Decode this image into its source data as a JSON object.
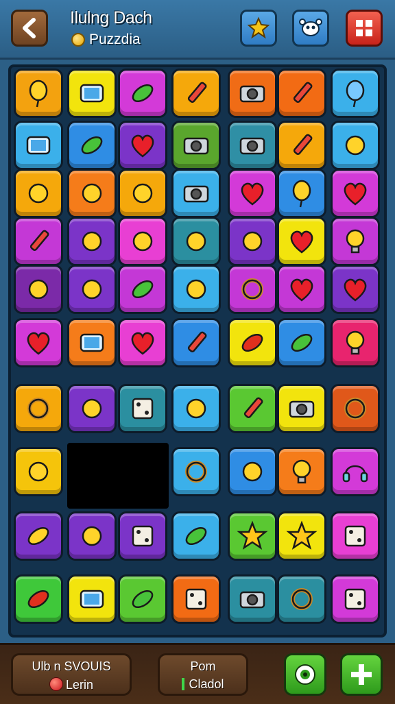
{
  "header": {
    "title": "Ilulng Dach",
    "subtitle": "Puzzdia",
    "back_icon": "back-arrow-icon",
    "buttons": [
      {
        "name": "star-badge-button",
        "icon": "star-badge-icon",
        "color": "#3f8fd6"
      },
      {
        "name": "character-button",
        "icon": "character-icon",
        "color": "#3f8fd6"
      },
      {
        "name": "grid-menu-button",
        "icon": "grid-icon",
        "color": "#e53a2a"
      }
    ]
  },
  "board": {
    "tiles": [
      {
        "bg": "#f3a20f",
        "icon": "balloon"
      },
      {
        "bg": "#f2e40d",
        "icon": "tablet"
      },
      {
        "bg": "#d33ad8",
        "icon": "pickle"
      },
      {
        "bg": "#f5a80b",
        "icon": "marker"
      },
      {
        "bg": "#f06c16",
        "icon": "machine"
      },
      {
        "bg": "#f26b14",
        "icon": "pen"
      },
      {
        "bg": "#3bb0ea",
        "icon": "water-drop"
      },
      {
        "bg": "#3bb0ea",
        "icon": "phone"
      },
      {
        "bg": "#2f8de4",
        "icon": "cucumber"
      },
      {
        "bg": "#7b34c8",
        "icon": "heart"
      },
      {
        "bg": "#5aa62d",
        "icon": "toaster"
      },
      {
        "bg": "#2f8fa5",
        "icon": "camera"
      },
      {
        "bg": "#f5a80b",
        "icon": "leaf-pen"
      },
      {
        "bg": "#3bb0ea",
        "icon": "tools"
      },
      {
        "bg": "#f5a80b",
        "icon": "dragon"
      },
      {
        "bg": "#f57c1a",
        "icon": "pig"
      },
      {
        "bg": "#f5a80b",
        "icon": "grass"
      },
      {
        "bg": "#3bb0ea",
        "icon": "radio"
      },
      {
        "bg": "#d33ad8",
        "icon": "heart"
      },
      {
        "bg": "#2f8de4",
        "icon": "balloon"
      },
      {
        "bg": "#d33ad8",
        "icon": "heart-balloon"
      },
      {
        "bg": "#c438d6",
        "icon": "pencil"
      },
      {
        "bg": "#7b34c8",
        "icon": "drops"
      },
      {
        "bg": "#e83fd3",
        "icon": "cheese"
      },
      {
        "bg": "#2b8fa0",
        "icon": "flashlight"
      },
      {
        "bg": "#7b34c8",
        "icon": "puzzle"
      },
      {
        "bg": "#f2e40d",
        "icon": "heart"
      },
      {
        "bg": "#c438d6",
        "icon": "lightbulb"
      },
      {
        "bg": "#7b2aa8",
        "icon": "rolling-pin"
      },
      {
        "bg": "#7b34c8",
        "icon": "bottle"
      },
      {
        "bg": "#c438d6",
        "icon": "leaf"
      },
      {
        "bg": "#3bb0ea",
        "icon": "bird"
      },
      {
        "bg": "#c438d6",
        "icon": "donut"
      },
      {
        "bg": "#c438d6",
        "icon": "heart-balloon"
      },
      {
        "bg": "#7b34c8",
        "icon": "heart"
      },
      {
        "bg": "#d33ad8",
        "icon": "heart"
      },
      {
        "bg": "#f57c1a",
        "icon": "phone-case"
      },
      {
        "bg": "#e83fd3",
        "icon": "heart"
      },
      {
        "bg": "#2f8de4",
        "icon": "marker"
      },
      {
        "bg": "#f2e40d",
        "icon": "chili"
      },
      {
        "bg": "#2f8de4",
        "icon": "speech"
      },
      {
        "bg": "#e8246e",
        "icon": "lightbulb"
      },
      {
        "bg": "#f5a80b",
        "icon": "ring"
      },
      {
        "bg": "#7b34c8",
        "icon": "scooter"
      },
      {
        "bg": "#2b8fa0",
        "icon": "dice"
      },
      {
        "bg": "#3bb0ea",
        "icon": "cookie"
      },
      {
        "bg": "#5ac832",
        "icon": "crayon"
      },
      {
        "bg": "#f2e40d",
        "icon": "device"
      },
      {
        "bg": "#e0581a",
        "icon": "no-sign"
      },
      {
        "bg": "#f5c40b",
        "icon": "joystick"
      },
      {
        "bg": "#3bb0ea",
        "icon": "magnifier"
      },
      {
        "bg": "#2f8de4",
        "icon": "hammer"
      },
      {
        "bg": "#f57c1a",
        "icon": "lightbulb"
      },
      {
        "bg": "#d33ad8",
        "icon": "headphones"
      },
      {
        "bg": "#7b34c8",
        "icon": "banana"
      },
      {
        "bg": "#7b34c8",
        "icon": "hairdryer"
      },
      {
        "bg": "#7b34c8",
        "icon": "book"
      },
      {
        "bg": "#3bb0ea",
        "icon": "leaf-pot"
      },
      {
        "bg": "#5ac832",
        "icon": "star"
      },
      {
        "bg": "#f2e40d",
        "icon": "star"
      },
      {
        "bg": "#e83fd3",
        "icon": "frame"
      },
      {
        "bg": "#3fc83a",
        "icon": "bean"
      },
      {
        "bg": "#f2e40d",
        "icon": "phone"
      },
      {
        "bg": "#5ac832",
        "icon": "speech"
      },
      {
        "bg": "#f26b14",
        "icon": "box"
      },
      {
        "bg": "#2b8fa0",
        "icon": "camera"
      },
      {
        "bg": "#2b8fa0",
        "icon": "gear-ring"
      },
      {
        "bg": "#d33ad8",
        "icon": "picture-frame"
      }
    ]
  },
  "footer": {
    "left_panel": {
      "line1": "Ulb n SVOUIS",
      "line2": "Lerin"
    },
    "center_panel": {
      "line1": "Pom",
      "line2": "Cladol"
    },
    "buttons": [
      {
        "name": "eye-refresh-button",
        "icon": "eye-refresh-icon"
      },
      {
        "name": "add-button",
        "icon": "plus-cross-icon"
      }
    ]
  }
}
